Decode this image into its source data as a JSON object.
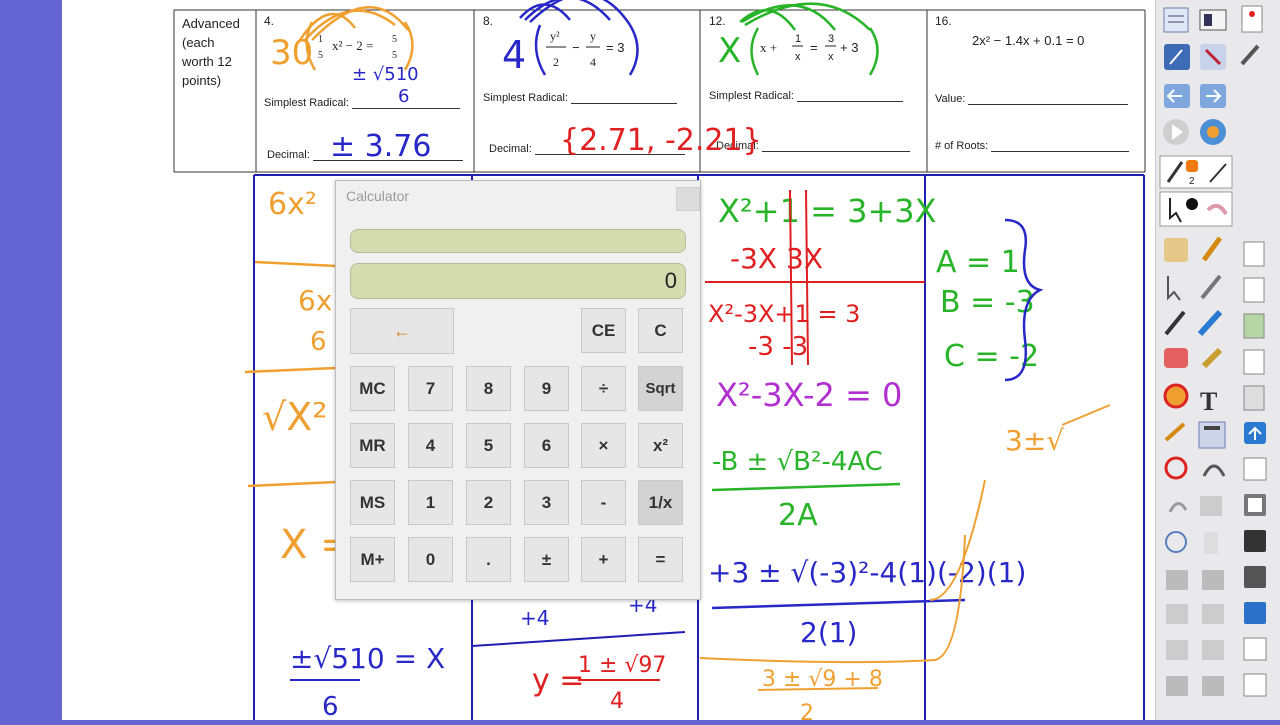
{
  "worksheet": {
    "row_label": "Advanced\n(each\nworth 12\npoints)",
    "problems": [
      {
        "number": "4.",
        "equation": "1/5 x² − 2 = 5/5",
        "simplest_label": "Simplest Radical:",
        "decimal_label": "Decimal:"
      },
      {
        "number": "8.",
        "equation": "y²/2 − y/4 = 3",
        "simplest_label": "Simplest Radical:",
        "decimal_label": "Decimal:"
      },
      {
        "number": "12.",
        "equation": "x + 1/x = 3/x + 3",
        "simplest_label": "Simplest Radical:",
        "decimal_label": "Decimal:"
      },
      {
        "number": "16.",
        "equation": "2x² − 1.4x + 0.1 = 0",
        "simplest_label": "Value:",
        "decimal_label": "# of Roots:"
      }
    ]
  },
  "handwriting": {
    "p4_multiplier": "30",
    "p4_radical": "± √510 / 6",
    "p4_decimal": "± 3.76",
    "p8_multiplier": "4",
    "p8_decimal": "{2.71, -2.21}",
    "p12_multiplier": "X",
    "work_col1": [
      "6x²",
      "6x",
      "6",
      "√x²",
      "X ="
    ],
    "work_col1_bottom": "± √510 / 6 = X",
    "work_col2_bottom": "y = 1 ± √97 / 4",
    "work_col3": [
      "X²+1 = 3+3X",
      "-3X  -3X",
      "X²-3X+1 = 3",
      "-3  -3",
      "X²-3X-2 = 0",
      "-B ± √B²-4AC",
      "2A",
      "+3 ± √(-3)²-4(1)(-2)",
      "2(1)",
      "3 ± √9 + 8",
      "2"
    ],
    "work_col4": [
      "A = 1",
      "B = -3",
      "C = -2",
      "3 ±"
    ]
  },
  "calculator": {
    "title": "Calculator",
    "display": "0",
    "memory": "",
    "buttons": {
      "backspace": "←",
      "ce": "CE",
      "c": "C",
      "mc": "MC",
      "seven": "7",
      "eight": "8",
      "nine": "9",
      "divide": "÷",
      "sqrt": "Sqrt",
      "mr": "MR",
      "four": "4",
      "five": "5",
      "six": "6",
      "multiply": "×",
      "square": "x²",
      "ms": "MS",
      "one": "1",
      "two": "2",
      "three": "3",
      "minus": "-",
      "reciprocal": "1/x",
      "mplus": "M+",
      "zero": "0",
      "dot": ".",
      "plusminus": "±",
      "plus": "+",
      "equals": "="
    }
  },
  "toolbar": {
    "page_number": "2",
    "tools": [
      "select-icon",
      "keyboard-icon",
      "page-icon",
      "pen-icon",
      "screen-shade-icon",
      "back-icon",
      "forward-icon",
      "play-icon",
      "gallery-icon",
      "pen-tool-icon",
      "highlighter-icon",
      "pointer-icon",
      "hand-icon",
      "eraser-icon",
      "text-icon",
      "calculator-icon",
      "upload-icon",
      "print-icon"
    ]
  },
  "colors": {
    "background": "#6464d2",
    "ink_orange": "#f0a030",
    "ink_blue": "#2828c8",
    "ink_green": "#28b428",
    "ink_red": "#e02020",
    "ink_purple": "#b030d0",
    "table_blue": "#2020b0",
    "calc_display": "#d4dcb0"
  }
}
